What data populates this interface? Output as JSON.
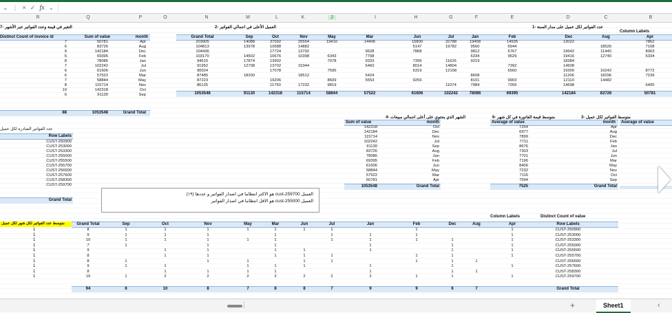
{
  "toolbar": {
    "fx": "fx",
    "cancel": "×",
    "confirm": "✓",
    "dots": "⋮",
    "dropdown": "⌄"
  },
  "columns": [
    "R",
    "Q",
    "P",
    "O",
    "N",
    "M",
    "L",
    "K",
    "J",
    "I",
    "H",
    "G",
    "F",
    "E",
    "D",
    "C",
    "B"
  ],
  "selected_column": "J",
  "sheet_tab": "Sheet1",
  "plus": "+",
  "titles": {
    "t1": "عدد الفواتير لكل عميل على مدار السنة -1",
    "t2": "العميل الأعلى في اجمالي الفواتير -2",
    "t7": "التغير في قيمة وعدد الفواتير عبر الأشهر -7",
    "t3": "متوسط الفواتير لكل عميل -3",
    "t4": "الشهر الذي يحتوي على أعلى اجمالي مبيعات -4",
    "t6": "متوسط قيمة الفاتورة في كل شهر -6",
    "t5": "عدد الفواتير الصادرة لكل عميل",
    "tyellow": "متوسط عدد الفواتير لكل شهر لكل عميل"
  },
  "pivot1": {
    "header": [
      "Grand Total",
      "Sep",
      "Oct",
      "Nov",
      "May",
      "Mar",
      "Jun",
      "Jul",
      "Jan",
      "Feb",
      "Dec",
      "Aug",
      "Apr"
    ],
    "column_labels": "Column Labels",
    "rows": [
      [
        "203905",
        "14088",
        "37592",
        "25554",
        "19410",
        "14406",
        "15800",
        "32788",
        "19458",
        "14935",
        "13022",
        "",
        "7862"
      ],
      [
        "104813",
        "13978",
        "10688",
        "14882",
        "",
        "",
        "5147",
        "19782",
        "9560",
        "6944",
        "",
        "18526",
        "7108"
      ],
      [
        "104436",
        "",
        "17724",
        "13792",
        "",
        "9528",
        "7868",
        "",
        "9812",
        "6767",
        "19642",
        "11440",
        "8063"
      ],
      [
        "103170",
        "14502",
        "10676",
        "10398",
        "6343",
        "7798",
        "",
        "",
        "6334",
        "9629",
        "19416",
        "12740",
        "5334"
      ],
      [
        "94615",
        "17874",
        "13902",
        "",
        "7078",
        "9333",
        "7399",
        "11626",
        "9219",
        "",
        "18384",
        "",
        ""
      ],
      [
        "91952",
        "12708",
        "13702",
        "15344",
        "",
        "5460",
        "8014",
        "14804",
        "",
        "7392",
        "14608",
        "",
        ""
      ],
      [
        "90024",
        "",
        "17078",
        "",
        "7595",
        "",
        "6319",
        "12168",
        "",
        "6560",
        "19300",
        "10242",
        "8772"
      ],
      [
        "87485",
        "18200",
        "",
        "18512",
        "",
        "5424",
        "",
        "",
        "8608",
        "",
        "11206",
        "18296",
        "7239"
      ],
      [
        "87223",
        "",
        "19206",
        "",
        "8609",
        "5553",
        "9259",
        "",
        "8101",
        "9903",
        "12110",
        "14482",
        ""
      ],
      [
        "86125",
        "",
        "11750",
        "17232",
        "9819",
        "",
        "",
        "11074",
        "7984",
        "7265",
        "14698",
        "",
        "6405"
      ],
      [
        "1053548",
        "91130",
        "142318",
        "115714",
        "58844",
        "57522",
        "61606",
        "102242",
        "78086",
        "69395",
        "142184",
        "83726",
        "50781"
      ]
    ]
  },
  "pivot7": {
    "header": [
      "Distinct Count of invoice id",
      "Sum of value",
      "month"
    ],
    "rows": [
      [
        "7",
        "50781",
        "Apr"
      ],
      [
        "6",
        "83726",
        "Aug"
      ],
      [
        "9",
        "142184",
        "Dec"
      ],
      [
        "6",
        "69395",
        "Feb"
      ],
      [
        "8",
        "78086",
        "Jan"
      ],
      [
        "7",
        "102242",
        "Jul"
      ],
      [
        "6",
        "61606",
        "Jun"
      ],
      [
        "6",
        "57522",
        "Mar"
      ],
      [
        "7",
        "58844",
        "May"
      ],
      [
        "8",
        "115714",
        "Nov"
      ],
      [
        "10",
        "142318",
        "Oct"
      ],
      [
        "6",
        "91130",
        "Sep"
      ]
    ],
    "total": [
      "88",
      "1053548",
      "Grand Total"
    ]
  },
  "pivot4": {
    "header": [
      "Sum of value",
      "month"
    ],
    "rows": [
      [
        "142318",
        "Oct"
      ],
      [
        "142184",
        "Dec"
      ],
      [
        "115714",
        "Nov"
      ],
      [
        "102242",
        "Jul"
      ],
      [
        "91130",
        "Sep"
      ],
      [
        "83726",
        "Aug"
      ],
      [
        "78086",
        "Jan"
      ],
      [
        "69395",
        "Feb"
      ],
      [
        "61606",
        "Jun"
      ],
      [
        "58844",
        "May"
      ],
      [
        "57522",
        "Mar"
      ],
      [
        "50781",
        "Apr"
      ]
    ],
    "total": [
      "1053548",
      "Grand Total"
    ]
  },
  "pivot6": {
    "header": [
      "Average of value",
      "month"
    ],
    "rows": [
      [
        "7254",
        "Apr"
      ],
      [
        "6977",
        "Aug"
      ],
      [
        "7899",
        "Dec"
      ],
      [
        "7711",
        "Feb"
      ],
      [
        "8676",
        "Jan"
      ],
      [
        "7303",
        "Jul"
      ],
      [
        "7701",
        "Jun"
      ],
      [
        "7190",
        "Mar"
      ],
      [
        "8406",
        "May"
      ],
      [
        "7232",
        "Nov"
      ],
      [
        "7116",
        "Oct"
      ],
      [
        "7594",
        "Sep"
      ]
    ],
    "total": [
      "7525",
      "Grand Total"
    ]
  },
  "pivot3": {
    "header": "Average of value"
  },
  "pivot5": {
    "header": "Row Labels",
    "rows": [
      "CUST-250900",
      "CUST-253000",
      "CUST-253300",
      "CUST-255000",
      "CUST-255500",
      "CUST-255700",
      "CUST-256500",
      "CUST-257600",
      "CUST-258300",
      "CUST-259700"
    ],
    "total": "Grand Total"
  },
  "note": {
    "line1": "العميل cust-259700 هو الاكثر انتظاما في اصدار الفواتير و عددها (١٩)",
    "line2": "العميل cust-255000 هو الاقل انتظاما في اصدار الفواتير"
  },
  "pivot8": {
    "column_labels": "Column Labels",
    "distinct": "Distinct Count of value",
    "header": [
      "Grand Total",
      "Sep",
      "Oct",
      "Nov",
      "May",
      "Mar",
      "Jun",
      "Jul",
      "Jan",
      "Feb",
      "Dec",
      "Aug",
      "Apr",
      "Row Labels"
    ],
    "rows": [
      [
        "8",
        "1",
        "1",
        "1",
        "1",
        "1",
        "1",
        "1",
        "",
        "1",
        "",
        "",
        "1",
        "CUST-250900"
      ],
      [
        "9",
        "1",
        "1",
        "1",
        "",
        "1",
        "",
        "1",
        "1",
        "1",
        "",
        "",
        "1",
        "CUST-253000"
      ],
      [
        "10",
        "1",
        "1",
        "1",
        "1",
        "1",
        "",
        "1",
        "1",
        "1",
        "1",
        "",
        "1",
        "CUST-253300"
      ],
      [
        "7",
        "1",
        "",
        "1",
        "",
        "1",
        "",
        "",
        "1",
        "",
        "1",
        "",
        "1",
        "CUST-255000"
      ],
      [
        "9",
        "",
        "1",
        "1",
        "",
        "1",
        "1",
        "",
        "1",
        "",
        "1",
        "",
        "1",
        "CUST-255500"
      ],
      [
        "8",
        "",
        "1",
        "1",
        "",
        "1",
        "1",
        "1",
        "",
        "1",
        "1",
        "",
        "1",
        "CUST-255700"
      ],
      [
        "8",
        "1",
        "",
        "1",
        "1",
        "",
        "1",
        "1",
        "",
        "1",
        "1",
        "1",
        "",
        "CUST-256500"
      ],
      [
        "9",
        "1",
        "1",
        "",
        "1",
        "1",
        "1",
        "",
        "1",
        "",
        "1",
        "",
        "1",
        "CUST-257600"
      ],
      [
        "8",
        "",
        "1",
        "1",
        "1",
        "1",
        "",
        "",
        "1",
        "",
        "1",
        "1",
        "",
        "CUST-258300"
      ],
      [
        "19",
        "1",
        "2",
        "2",
        "2",
        "2",
        "2",
        "2",
        "2",
        "1",
        "1",
        "",
        "1",
        "CUST-259700"
      ],
      [
        "94",
        "6",
        "10",
        "8",
        "7",
        "8",
        "8",
        "7",
        "9",
        "9",
        "6",
        "7",
        "",
        "Grand Total"
      ]
    ],
    "left_ones": [
      "1",
      "1",
      "1",
      "1",
      "1",
      "1",
      "1",
      "1",
      "1",
      "1"
    ]
  }
}
